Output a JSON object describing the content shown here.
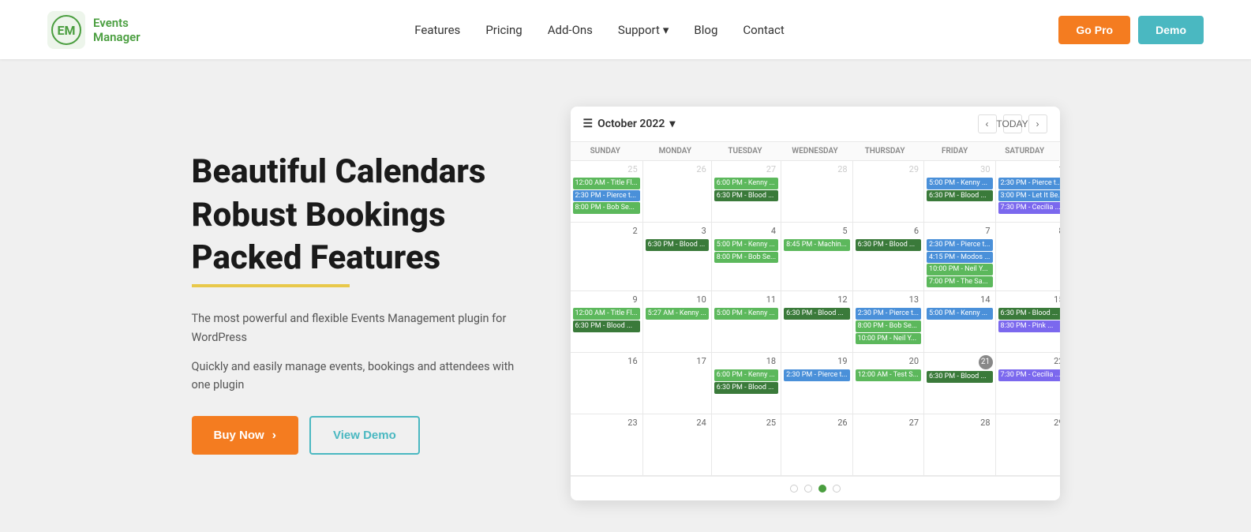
{
  "header": {
    "logo_line1": "Events",
    "logo_line2": "Manager",
    "nav_items": [
      {
        "label": "Features",
        "id": "features"
      },
      {
        "label": "Pricing",
        "id": "pricing"
      },
      {
        "label": "Add-Ons",
        "id": "addons"
      },
      {
        "label": "Support",
        "id": "support",
        "has_dropdown": true
      },
      {
        "label": "Blog",
        "id": "blog"
      },
      {
        "label": "Contact",
        "id": "contact"
      }
    ],
    "btn_gopro": "Go Pro",
    "btn_demo": "Demo"
  },
  "hero": {
    "line1": "Beautiful Calendars",
    "line2": "Robust Bookings",
    "line3": "Packed Features",
    "desc1": "The most powerful and flexible Events Management plugin for WordPress",
    "desc2": "Quickly and easily manage events, bookings and attendees with one plugin",
    "btn_buynow": "Buy Now",
    "btn_viewdemo": "View Demo"
  },
  "calendar": {
    "month": "October 2022",
    "today_label": "TODAY",
    "day_headers": [
      "SUNDAY",
      "MONDAY",
      "TUESDAY",
      "WEDNESDAY",
      "THURSDAY",
      "FRIDAY",
      "SATURDAY"
    ],
    "dots": [
      false,
      false,
      true,
      false
    ]
  }
}
